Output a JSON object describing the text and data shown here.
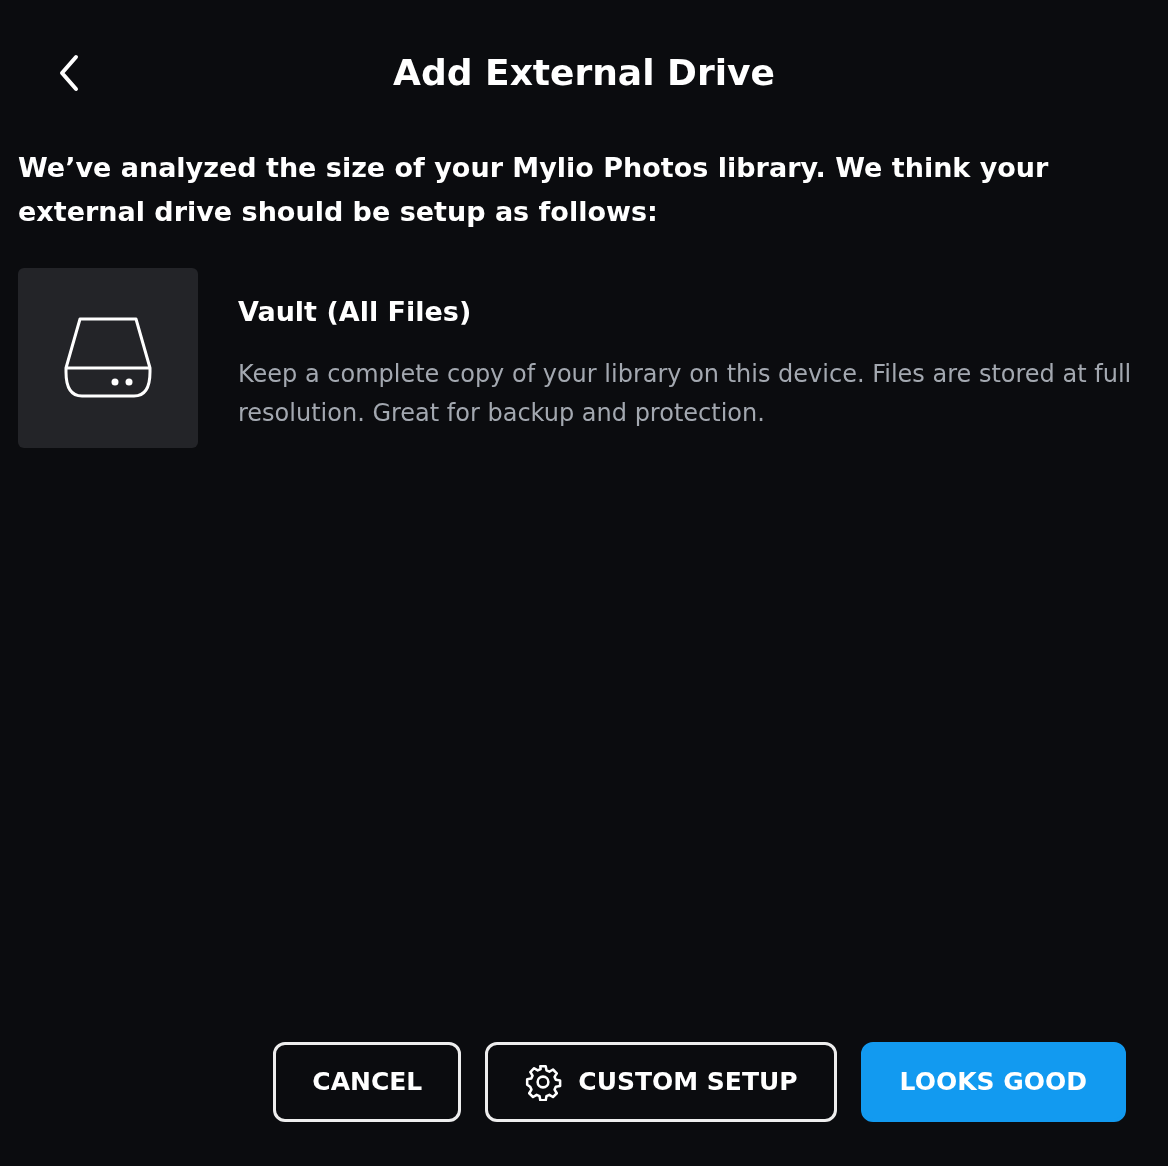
{
  "header": {
    "title": "Add External Drive"
  },
  "intro": "We’ve analyzed the size of your Mylio Photos library. We think your external drive should be setup as follows:",
  "option": {
    "title": "Vault (All Files)",
    "description": "Keep a complete copy of your library on this device. Files are stored at full resolution. Great for backup and protection."
  },
  "buttons": [
    {
      "label": "CANCEL",
      "kind": "outline"
    },
    {
      "label": "CUSTOM SETUP",
      "kind": "settings"
    },
    {
      "label": "LOOKS GOOD",
      "kind": "primary"
    }
  ]
}
